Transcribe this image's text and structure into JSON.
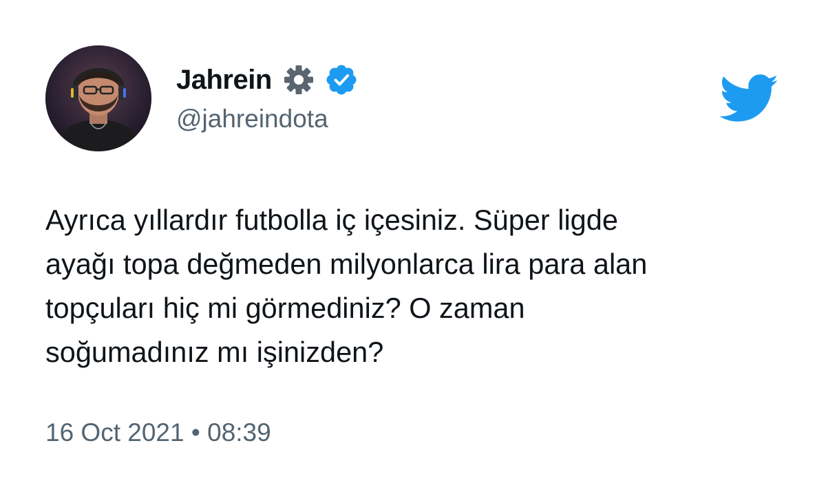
{
  "author": {
    "display_name": "Jahrein",
    "handle": "@jahreindota",
    "avatar": "profile-photo"
  },
  "badges": {
    "gear_icon": "gear-icon",
    "verified_icon": "verified-badge-icon"
  },
  "logo": "twitter-bird-icon",
  "tweet": {
    "text": "Ayrıca yıllardır futbolla iç içesiniz. Süper ligde\nayağı topa değmeden milyonlarca lira para alan\ntopçuları hiç mi görmediniz? O zaman\nsoğumadınız mı işinizden?",
    "date": "16 Oct 2021",
    "separator": "•",
    "time": "08:39"
  },
  "colors": {
    "text": "#0f1419",
    "secondary": "#536471",
    "twitter_blue": "#1d9bf0"
  }
}
